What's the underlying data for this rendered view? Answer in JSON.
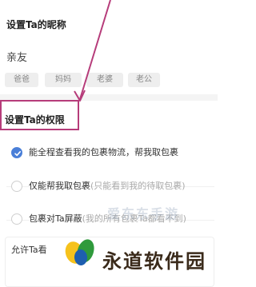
{
  "nickname": {
    "title": "设置Ta的昵称",
    "value": "亲友",
    "chips": [
      "爸爸",
      "妈妈",
      "老婆",
      "老公"
    ]
  },
  "permissions": {
    "title": "设置Ta的权限",
    "options": [
      {
        "label": "能全程查看我的包裹物流，帮我取包裹",
        "hint": "",
        "selected": true
      },
      {
        "label": "仅能帮我取包裹",
        "hint": "(只能看到我的待取包裹)",
        "selected": false
      },
      {
        "label": "包裹对Ta屏蔽",
        "hint": "(我的所有包裹Ta都看不到)",
        "selected": false
      }
    ]
  },
  "allow": {
    "text": "允许Ta看"
  },
  "watermark": {
    "site": "爱东东手游",
    "brand": "永道软件园"
  },
  "colors": {
    "accent": "#4a7fd8",
    "highlight": "#b63c7a"
  }
}
